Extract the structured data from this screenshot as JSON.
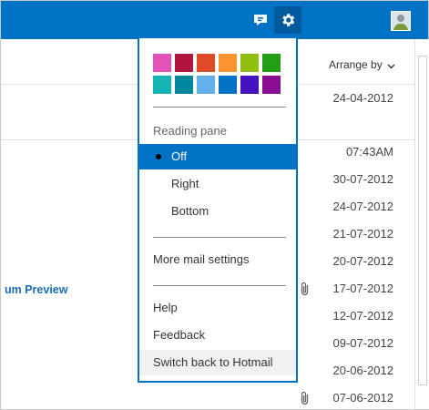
{
  "colors": {
    "accent": "#0072c6",
    "selected_row": "#0072c6",
    "hover_row": "#f1f1f1"
  },
  "toolbar": {
    "chat_icon": "chat-icon",
    "settings_icon": "gear-icon",
    "avatar": "avatar"
  },
  "mail_list": {
    "arrange_label": "Arrange by",
    "preview_link": "um Preview",
    "dates": [
      "24-04-2012",
      "07:43AM",
      "30-07-2012",
      "24-07-2012",
      "21-07-2012",
      "20-07-2012",
      "17-07-2012",
      "12-07-2012",
      "09-07-2012",
      "20-06-2012",
      "07-06-2012"
    ]
  },
  "settings_menu": {
    "swatches": [
      "#e252b7",
      "#b0163d",
      "#df4b26",
      "#fc942f",
      "#91be11",
      "#229d15",
      "#16b5b3",
      "#00869c",
      "#62b1ea",
      "#0071c5",
      "#4412c0",
      "#8a0d94"
    ],
    "reading_pane_label": "Reading pane",
    "reading_pane_options": [
      {
        "label": "Off",
        "selected": true
      },
      {
        "label": "Right",
        "selected": false
      },
      {
        "label": "Bottom",
        "selected": false
      }
    ],
    "more_settings": "More mail settings",
    "help": "Help",
    "feedback": "Feedback",
    "switch_back": "Switch back to Hotmail"
  }
}
